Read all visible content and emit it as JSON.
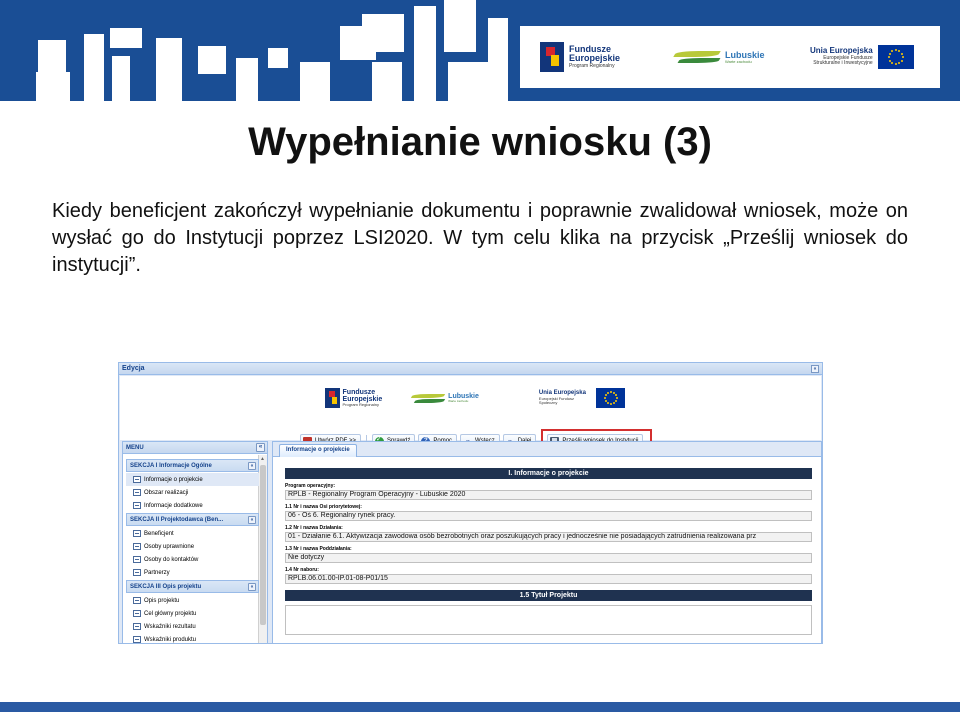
{
  "banner": {
    "funds_logo": {
      "line1": "Fundusze",
      "line2": "Europejskie",
      "line3": "Program Regionalny"
    },
    "lubuskie_logo": {
      "line1": "Lubuskie",
      "line2": "Warte zachodu"
    },
    "eu_logo": {
      "line1": "Unia Europejska",
      "line2": "Europejskie Fundusze",
      "line3": "Strukturalne i Inwestycyjne"
    }
  },
  "slide": {
    "title": "Wypełnianie wniosku (3)",
    "body": "Kiedy beneficjent zakończył wypełnianie dokumentu i poprawnie zwalidował wniosek, może on wysłać go do Instytucji poprzez LSI2020. W tym celu klika na przycisk „Prześlij wniosek do instytucji”."
  },
  "app": {
    "window_title": "Edycja",
    "window_tool": "«",
    "logos": {
      "funds": {
        "line1": "Fundusze",
        "line2": "Europejskie",
        "line3": "Program Regionalny"
      },
      "lubuskie": {
        "line1": "Lubuskie",
        "line2": "Warte zachodu"
      },
      "eu": {
        "line1": "Unia Europejska",
        "line2": "Europejski Fundusz Społeczny"
      }
    },
    "toolbar": {
      "pdf": "Utwórz PDF >>",
      "check": "Sprawdź",
      "help": "Pomoc",
      "help_glyph": "?",
      "back": "Wstecz",
      "back_glyph": "«",
      "next": "Dalej",
      "next_glyph": "»",
      "send": "Prześlij wniosek do Instytucji"
    },
    "menu": {
      "title": "MENU",
      "collapse_glyph": "«",
      "scroll_glyph": "▲",
      "section_glyph": "«",
      "sections": [
        {
          "title": "SEKCJA I Informacje Ogólne",
          "items": [
            "Informacje o projekcie",
            "Obszar realizacji",
            "Informacje dodatkowe"
          ]
        },
        {
          "title": "SEKCJA II Projektodawca (Ben...",
          "items": [
            "Beneficjent",
            "Osoby uprawnione",
            "Osoby do kontaktów",
            "Partnerzy"
          ]
        },
        {
          "title": "SEKCJA III Opis projektu",
          "items": [
            "Opis projektu",
            "Cel główny projektu",
            "Wskaźniki rezultatu",
            "Wskaźniki produktu"
          ]
        }
      ]
    },
    "content": {
      "tab": "Informacje o projekcie",
      "section_title": "I. Informacje o projekcie",
      "fields": [
        {
          "label": "Program operacyjny:",
          "value": "RPLB - Regionalny Program Operacyjny - Lubuskie 2020"
        },
        {
          "label": "1.1 Nr i nazwa Osi priorytetowej:",
          "value": "06 - Oś 6. Regionalny rynek pracy."
        },
        {
          "label": "1.2 Nr i nazwa Działania:",
          "value": "01 - Działanie 6.1. Aktywizacja zawodowa osób bezrobotnych oraz poszukujących pracy i jednocześnie nie posiadających zatrudnienia realizowana prz"
        },
        {
          "label": "1.3 Nr i nazwa Poddziałania:",
          "value": "Nie dotyczy"
        },
        {
          "label": "1.4 Nr naboru:",
          "value": "RPLB.06.01.00-IP.01-08-P01/15"
        }
      ],
      "section2_title": "1.5 Tytuł Projektu"
    }
  },
  "colors": {
    "banner_blue": "#1a4e95",
    "section_bar": "#1f3250",
    "highlight_red": "#d32f2f",
    "ext_header": "#c5d7ef"
  }
}
